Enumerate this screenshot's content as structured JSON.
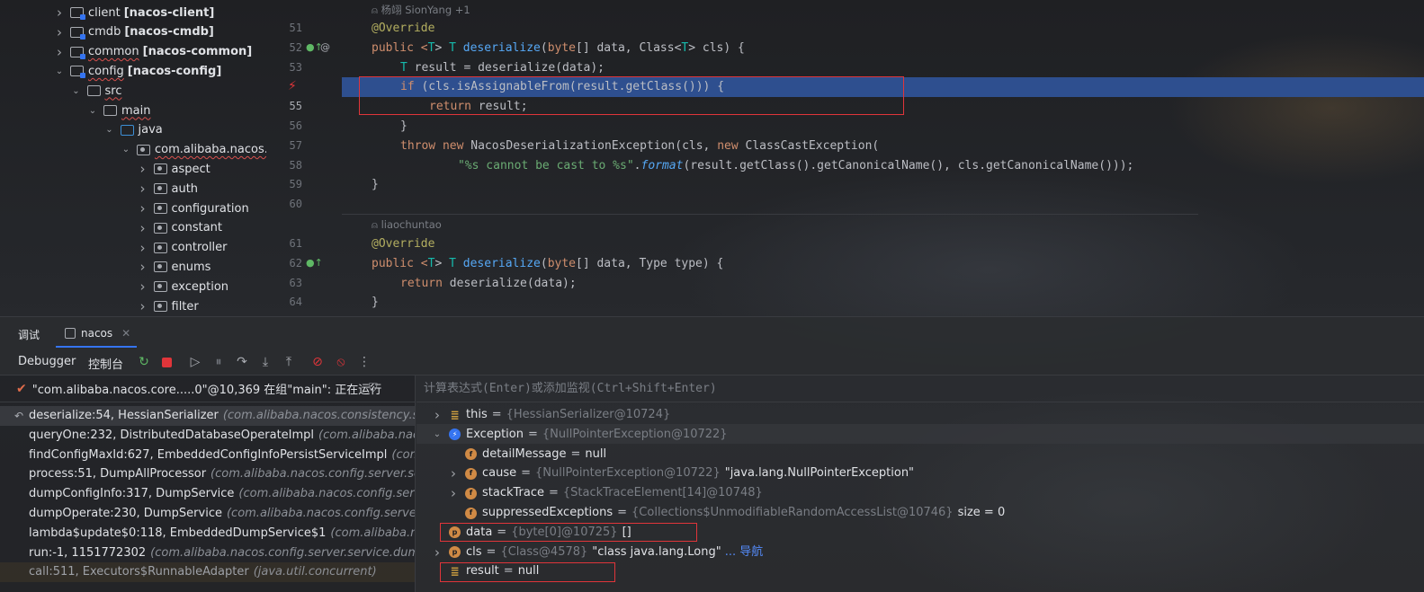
{
  "project_tree": {
    "items": [
      {
        "name": "client",
        "module": "[nacos-client]",
        "kind": "module",
        "expanded": false,
        "indent": 0
      },
      {
        "name": "cmdb",
        "module": "[nacos-cmdb]",
        "kind": "module",
        "expanded": false,
        "indent": 0
      },
      {
        "name": "common",
        "module": "[nacos-common]",
        "kind": "module",
        "expanded": false,
        "indent": 0
      },
      {
        "name": "config",
        "module": "[nacos-config]",
        "kind": "module",
        "expanded": true,
        "indent": 0
      },
      {
        "name": "src",
        "module": "",
        "kind": "src",
        "expanded": true,
        "indent": 1
      },
      {
        "name": "main",
        "module": "",
        "kind": "src",
        "expanded": true,
        "indent": 2
      },
      {
        "name": "java",
        "module": "",
        "kind": "java",
        "expanded": true,
        "indent": 3
      },
      {
        "name": "com.alibaba.nacos.c",
        "module": "",
        "kind": "pkg",
        "expanded": true,
        "indent": 4
      },
      {
        "name": "aspect",
        "module": "",
        "kind": "pkg",
        "expanded": false,
        "indent": 5
      },
      {
        "name": "auth",
        "module": "",
        "kind": "pkg",
        "expanded": false,
        "indent": 5
      },
      {
        "name": "configuration",
        "module": "",
        "kind": "pkg",
        "expanded": false,
        "indent": 5
      },
      {
        "name": "constant",
        "module": "",
        "kind": "pkg",
        "expanded": false,
        "indent": 5
      },
      {
        "name": "controller",
        "module": "",
        "kind": "pkg",
        "expanded": false,
        "indent": 5
      },
      {
        "name": "enums",
        "module": "",
        "kind": "pkg",
        "expanded": false,
        "indent": 5
      },
      {
        "name": "exception",
        "module": "",
        "kind": "pkg",
        "expanded": false,
        "indent": 5
      },
      {
        "name": "filter",
        "module": "",
        "kind": "pkg",
        "expanded": false,
        "indent": 5
      }
    ]
  },
  "editor": {
    "author_1": "杨翊 SionYang +1",
    "author_2": "liaochuntao",
    "line_numbers": [
      "51",
      "52",
      "53",
      "",
      "55",
      "56",
      "57",
      "58",
      "59",
      "60",
      "61",
      "62",
      "63",
      "64"
    ],
    "lines": {
      "l51": "@Override",
      "l52_a": "public <",
      "l52_t1": "T",
      "l52_b": "> ",
      "l52_t2": "T",
      "l52_sp": " ",
      "l52_fn": "deserialize",
      "l52_c": "(",
      "l52_kw": "byte",
      "l52_d": "[] data, Class<",
      "l52_t3": "T",
      "l52_e": "> cls) {",
      "l53_t": "T",
      "l53_r": " result = deserialize(data);",
      "l54_kw": "if",
      "l54_r": " (cls.isAssignableFrom(result.getClass())) {",
      "l55_kw": "return",
      "l55_r": " result;",
      "l56": "}",
      "l57_kw": "throw",
      "l57_sp": " ",
      "l57_kw2": "new",
      "l57_a": " NacosDeserializationException(cls, ",
      "l57_kw3": "new",
      "l57_b": " ClassCastException(",
      "l58_s": "\"%s cannot be cast to %s\"",
      "l58_dot": ".",
      "l58_it": "format",
      "l58_r": "(result.getClass().getCanonicalName(), cls.getCanonicalName()));",
      "l59": "}",
      "l61": "@Override",
      "l62_a": "public <",
      "l62_t1": "T",
      "l62_b": "> ",
      "l62_t2": "T",
      "l62_sp": " ",
      "l62_fn": "deserialize",
      "l62_c": "(",
      "l62_kw": "byte",
      "l62_d": "[] data, Type type) {",
      "l63_kw": "return",
      "l63_r": " deserialize(data);",
      "l64": "}"
    }
  },
  "tool_window": {
    "title": "调试",
    "tab_label": "nacos"
  },
  "toolbar": {
    "debugger_label": "Debugger",
    "console_label": "控制台"
  },
  "frames": {
    "thread_status": "\"com.alibaba.nacos.core.....0\"@10,369 在组\"main\": 正在运行",
    "items": [
      {
        "method": "deserialize:54, HessianSerializer",
        "pkg": "(com.alibaba.nacos.consistency.serialize)"
      },
      {
        "method": "queryOne:232, DistributedDatabaseOperateImpl",
        "pkg": "(com.alibaba.nacos.config.server.service)"
      },
      {
        "method": "findConfigMaxId:627, EmbeddedConfigInfoPersistServiceImpl",
        "pkg": "(com.alibaba.nacos.config)"
      },
      {
        "method": "process:51, DumpAllProcessor",
        "pkg": "(com.alibaba.nacos.config.server.service.dump)"
      },
      {
        "method": "dumpConfigInfo:317, DumpService",
        "pkg": "(com.alibaba.nacos.config.server.service)"
      },
      {
        "method": "dumpOperate:230, DumpService",
        "pkg": "(com.alibaba.nacos.config.server.service)"
      },
      {
        "method": "lambda$update$0:118, EmbeddedDumpService$1",
        "pkg": "(com.alibaba.nacos.config)"
      },
      {
        "method": "run:-1, 1151772302",
        "pkg": "(com.alibaba.nacos.config.server.service.dump.EmbeddedDumpService)"
      },
      {
        "method": "call:511, Executors$RunnableAdapter",
        "pkg": "(java.util.concurrent)"
      }
    ]
  },
  "variables": {
    "eval_placeholder": "计算表达式(Enter)或添加监视(Ctrl+Shift+Enter)",
    "items": [
      {
        "name": "this",
        "type": "{HessianSerializer@10724}",
        "value": "",
        "icon": "list",
        "chev": "right",
        "indent": 0
      },
      {
        "name": "Exception",
        "type": "{NullPointerException@10722}",
        "value": "",
        "icon": "exc",
        "chev": "down",
        "indent": 0
      },
      {
        "name": "detailMessage",
        "type": "",
        "value": "null",
        "icon": "f",
        "chev": "",
        "indent": 1
      },
      {
        "name": "cause",
        "type": "{NullPointerException@10722}",
        "value": "\"java.lang.NullPointerException\"",
        "icon": "f",
        "chev": "right",
        "indent": 1
      },
      {
        "name": "stackTrace",
        "type": "{StackTraceElement[14]@10748}",
        "value": "",
        "icon": "f",
        "chev": "right",
        "indent": 1
      },
      {
        "name": "suppressedExceptions",
        "type": "{Collections$UnmodifiableRandomAccessList@10746}",
        "value": "size = 0",
        "icon": "f",
        "chev": "",
        "indent": 1
      },
      {
        "name": "data",
        "type": "{byte[0]@10725}",
        "value": "[]",
        "icon": "p",
        "chev": "",
        "indent": 0
      },
      {
        "name": "cls",
        "type": "{Class@4578}",
        "value": "\"class java.lang.Long\"",
        "icon": "p",
        "chev": "right",
        "indent": 0
      },
      {
        "name": "result",
        "type": "",
        "value": "null",
        "icon": "list",
        "chev": "",
        "indent": 0
      }
    ],
    "cls_link": "... 导航"
  }
}
